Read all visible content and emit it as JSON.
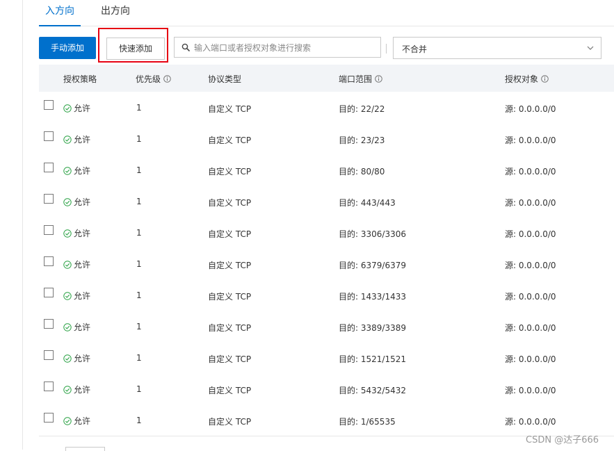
{
  "tabs": [
    {
      "label": "入方向",
      "active": true
    },
    {
      "label": "出方向",
      "active": false
    }
  ],
  "toolbar": {
    "manual_add_label": "手动添加",
    "quick_add_label": "快速添加",
    "search_placeholder": "输入端口或者授权对象进行搜索",
    "merge_select_value": "不合并"
  },
  "table": {
    "headers": {
      "policy": "授权策略",
      "priority": "优先级",
      "protocol": "协议类型",
      "port_range": "端口范围",
      "auth_object": "授权对象"
    },
    "rows": [
      {
        "policy": "允许",
        "priority": "1",
        "protocol": "自定义 TCP",
        "port": "目的: 22/22",
        "object": "源: 0.0.0.0/0"
      },
      {
        "policy": "允许",
        "priority": "1",
        "protocol": "自定义 TCP",
        "port": "目的: 23/23",
        "object": "源: 0.0.0.0/0"
      },
      {
        "policy": "允许",
        "priority": "1",
        "protocol": "自定义 TCP",
        "port": "目的: 80/80",
        "object": "源: 0.0.0.0/0"
      },
      {
        "policy": "允许",
        "priority": "1",
        "protocol": "自定义 TCP",
        "port": "目的: 443/443",
        "object": "源: 0.0.0.0/0"
      },
      {
        "policy": "允许",
        "priority": "1",
        "protocol": "自定义 TCP",
        "port": "目的: 3306/3306",
        "object": "源: 0.0.0.0/0"
      },
      {
        "policy": "允许",
        "priority": "1",
        "protocol": "自定义 TCP",
        "port": "目的: 6379/6379",
        "object": "源: 0.0.0.0/0"
      },
      {
        "policy": "允许",
        "priority": "1",
        "protocol": "自定义 TCP",
        "port": "目的: 1433/1433",
        "object": "源: 0.0.0.0/0"
      },
      {
        "policy": "允许",
        "priority": "1",
        "protocol": "自定义 TCP",
        "port": "目的: 3389/3389",
        "object": "源: 0.0.0.0/0"
      },
      {
        "policy": "允许",
        "priority": "1",
        "protocol": "自定义 TCP",
        "port": "目的: 1521/1521",
        "object": "源: 0.0.0.0/0"
      },
      {
        "policy": "允许",
        "priority": "1",
        "protocol": "自定义 TCP",
        "port": "目的: 5432/5432",
        "object": "源: 0.0.0.0/0"
      },
      {
        "policy": "允许",
        "priority": "1",
        "protocol": "自定义 TCP",
        "port": "目的: 1/65535",
        "object": "源: 0.0.0.0/0"
      }
    ]
  },
  "watermark": "CSDN @达子666",
  "colors": {
    "accent": "#0070cc",
    "highlight": "#e60012",
    "allow_green": "#2ba245",
    "header_bg": "#f2f4f7"
  },
  "icons": {
    "search": "search-icon",
    "info": "info-icon",
    "allow": "check-circle-icon",
    "dropdown": "chevron-down-icon"
  }
}
